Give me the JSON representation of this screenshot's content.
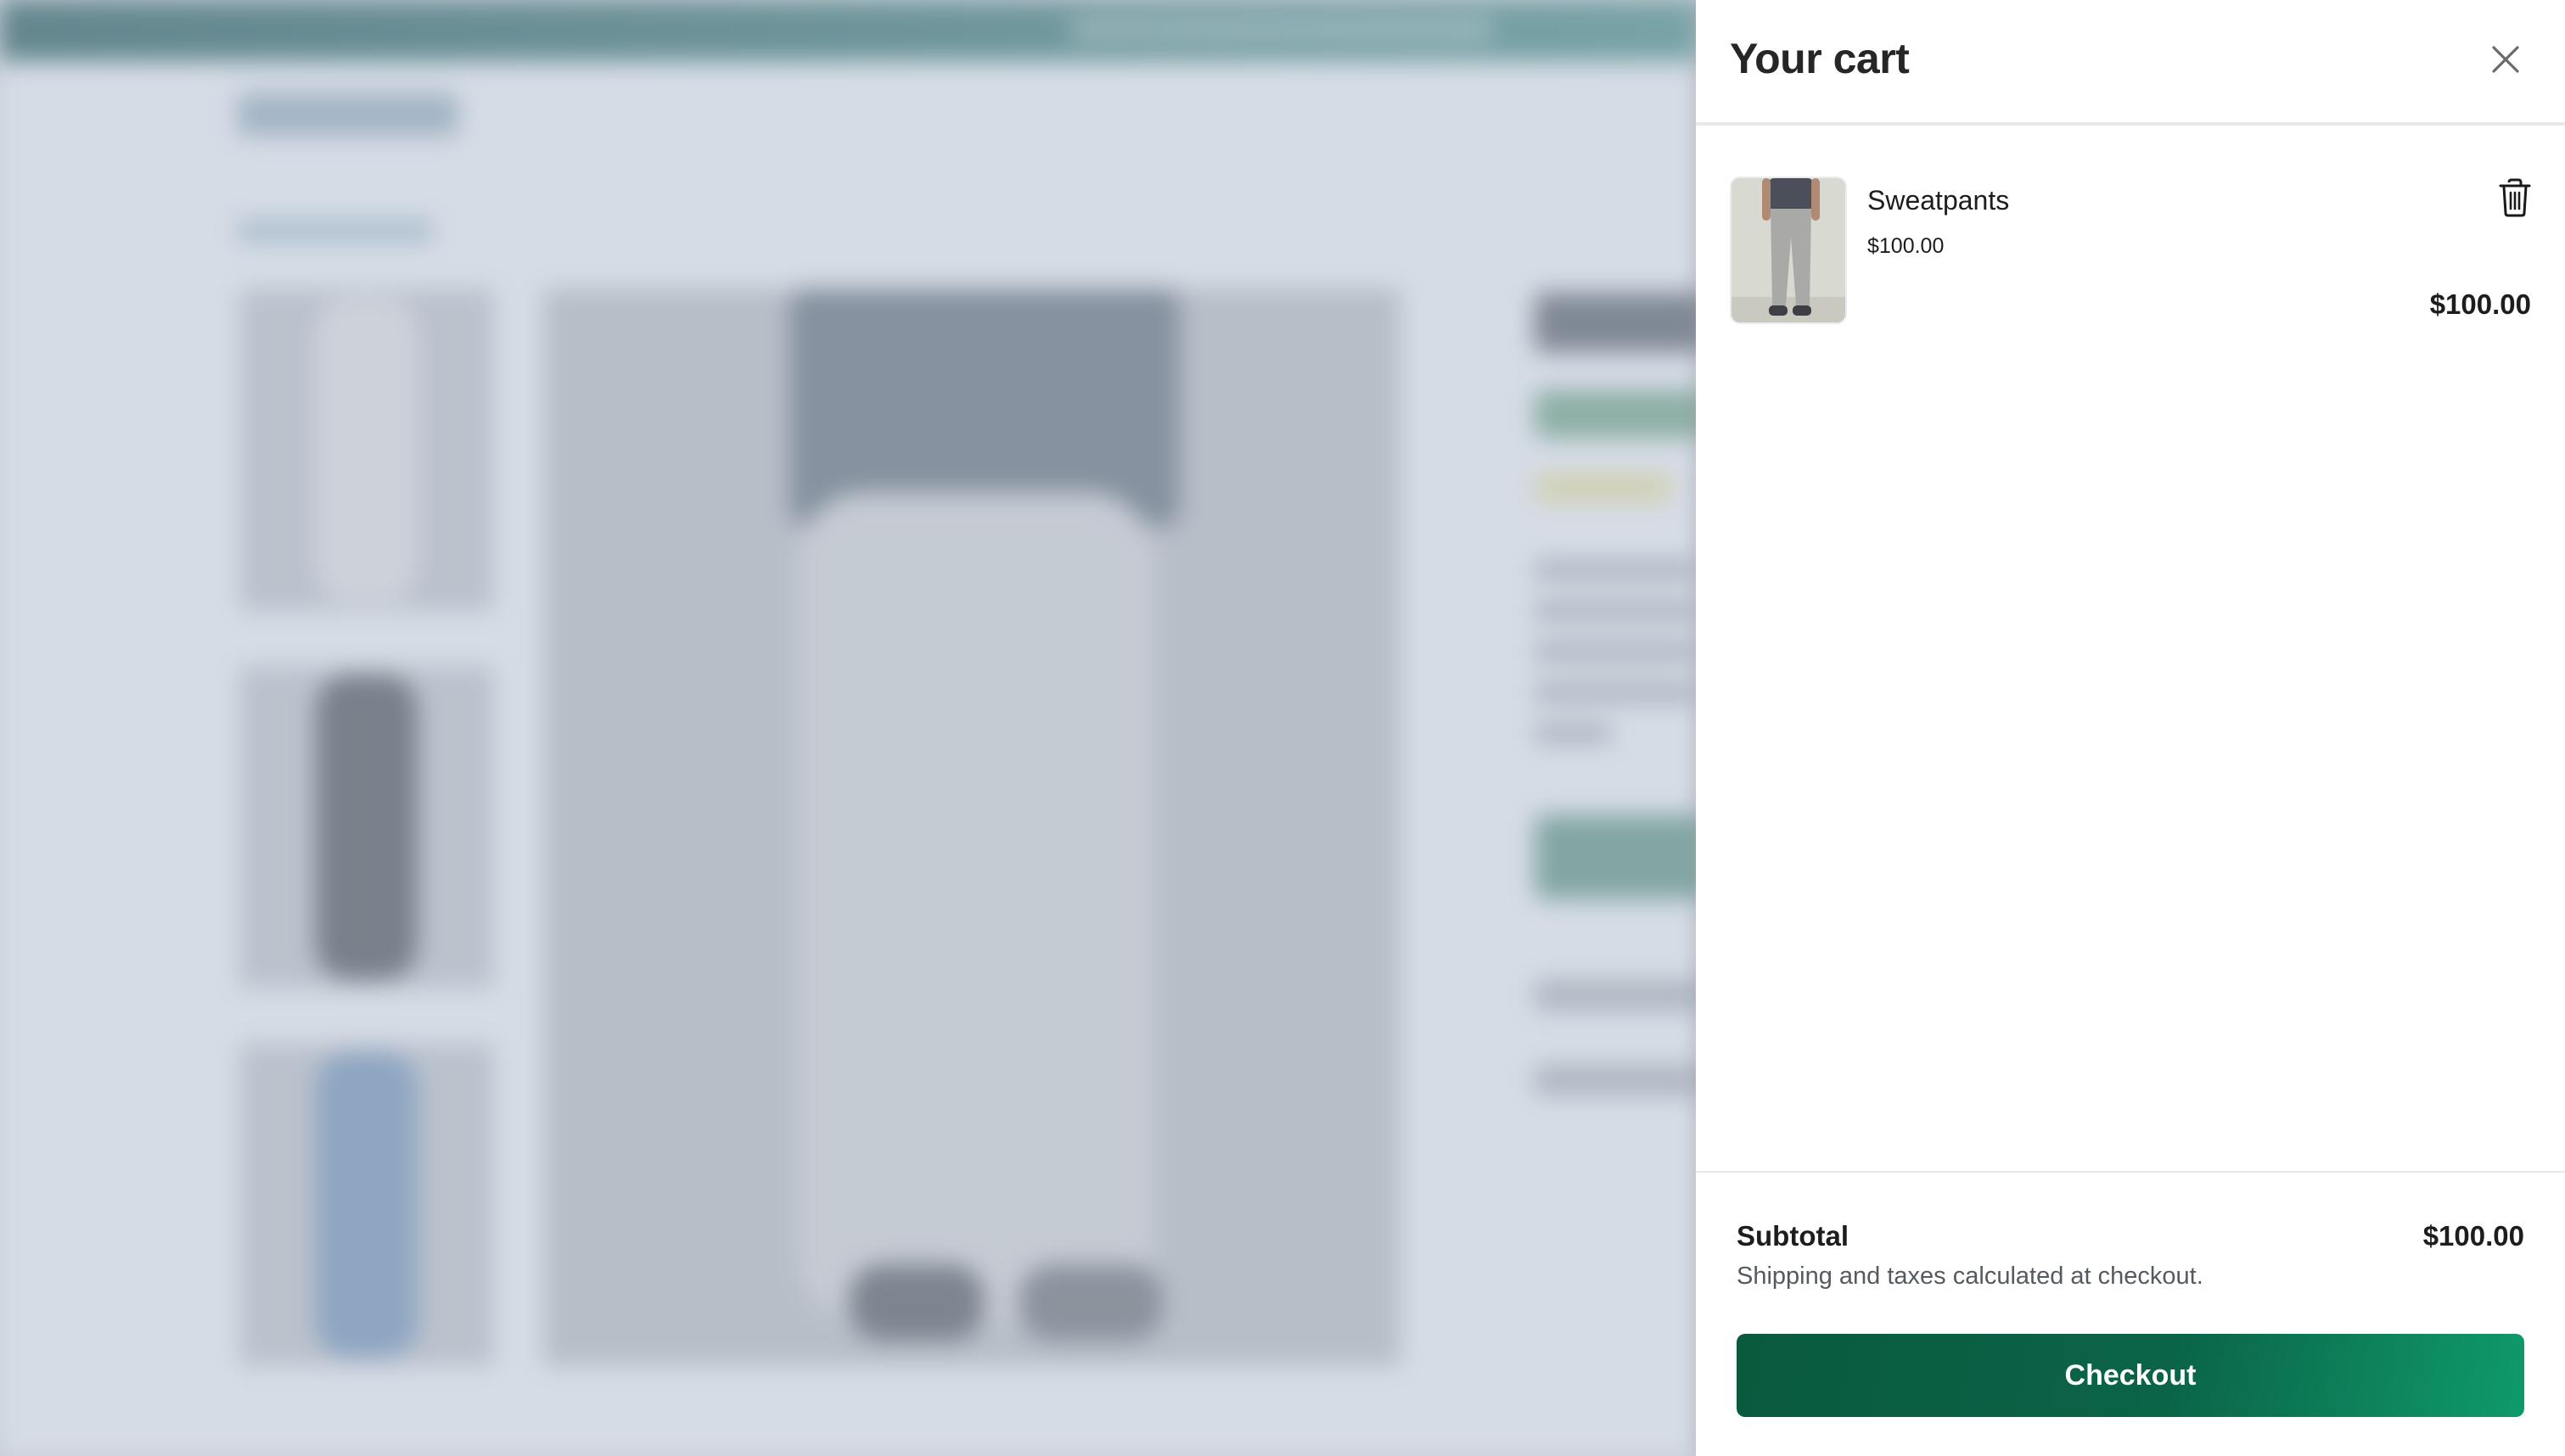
{
  "cart": {
    "title": "Your cart",
    "close_icon": "close-icon",
    "items": [
      {
        "name": "Sweatpants",
        "unit_price": "$100.00",
        "line_total": "$100.00",
        "thumbnail": "sweatpants-product-image",
        "remove_icon": "trash-icon"
      }
    ],
    "subtotal_label": "Subtotal",
    "subtotal_value": "$100.00",
    "shipping_note": "Shipping and taxes calculated at checkout.",
    "checkout_label": "Checkout"
  },
  "colors": {
    "checkout_start": "#0a5a3e",
    "checkout_end": "#0f9a6b",
    "backdrop_tint": "#c9ced8",
    "topbar": "#2e5f64"
  }
}
